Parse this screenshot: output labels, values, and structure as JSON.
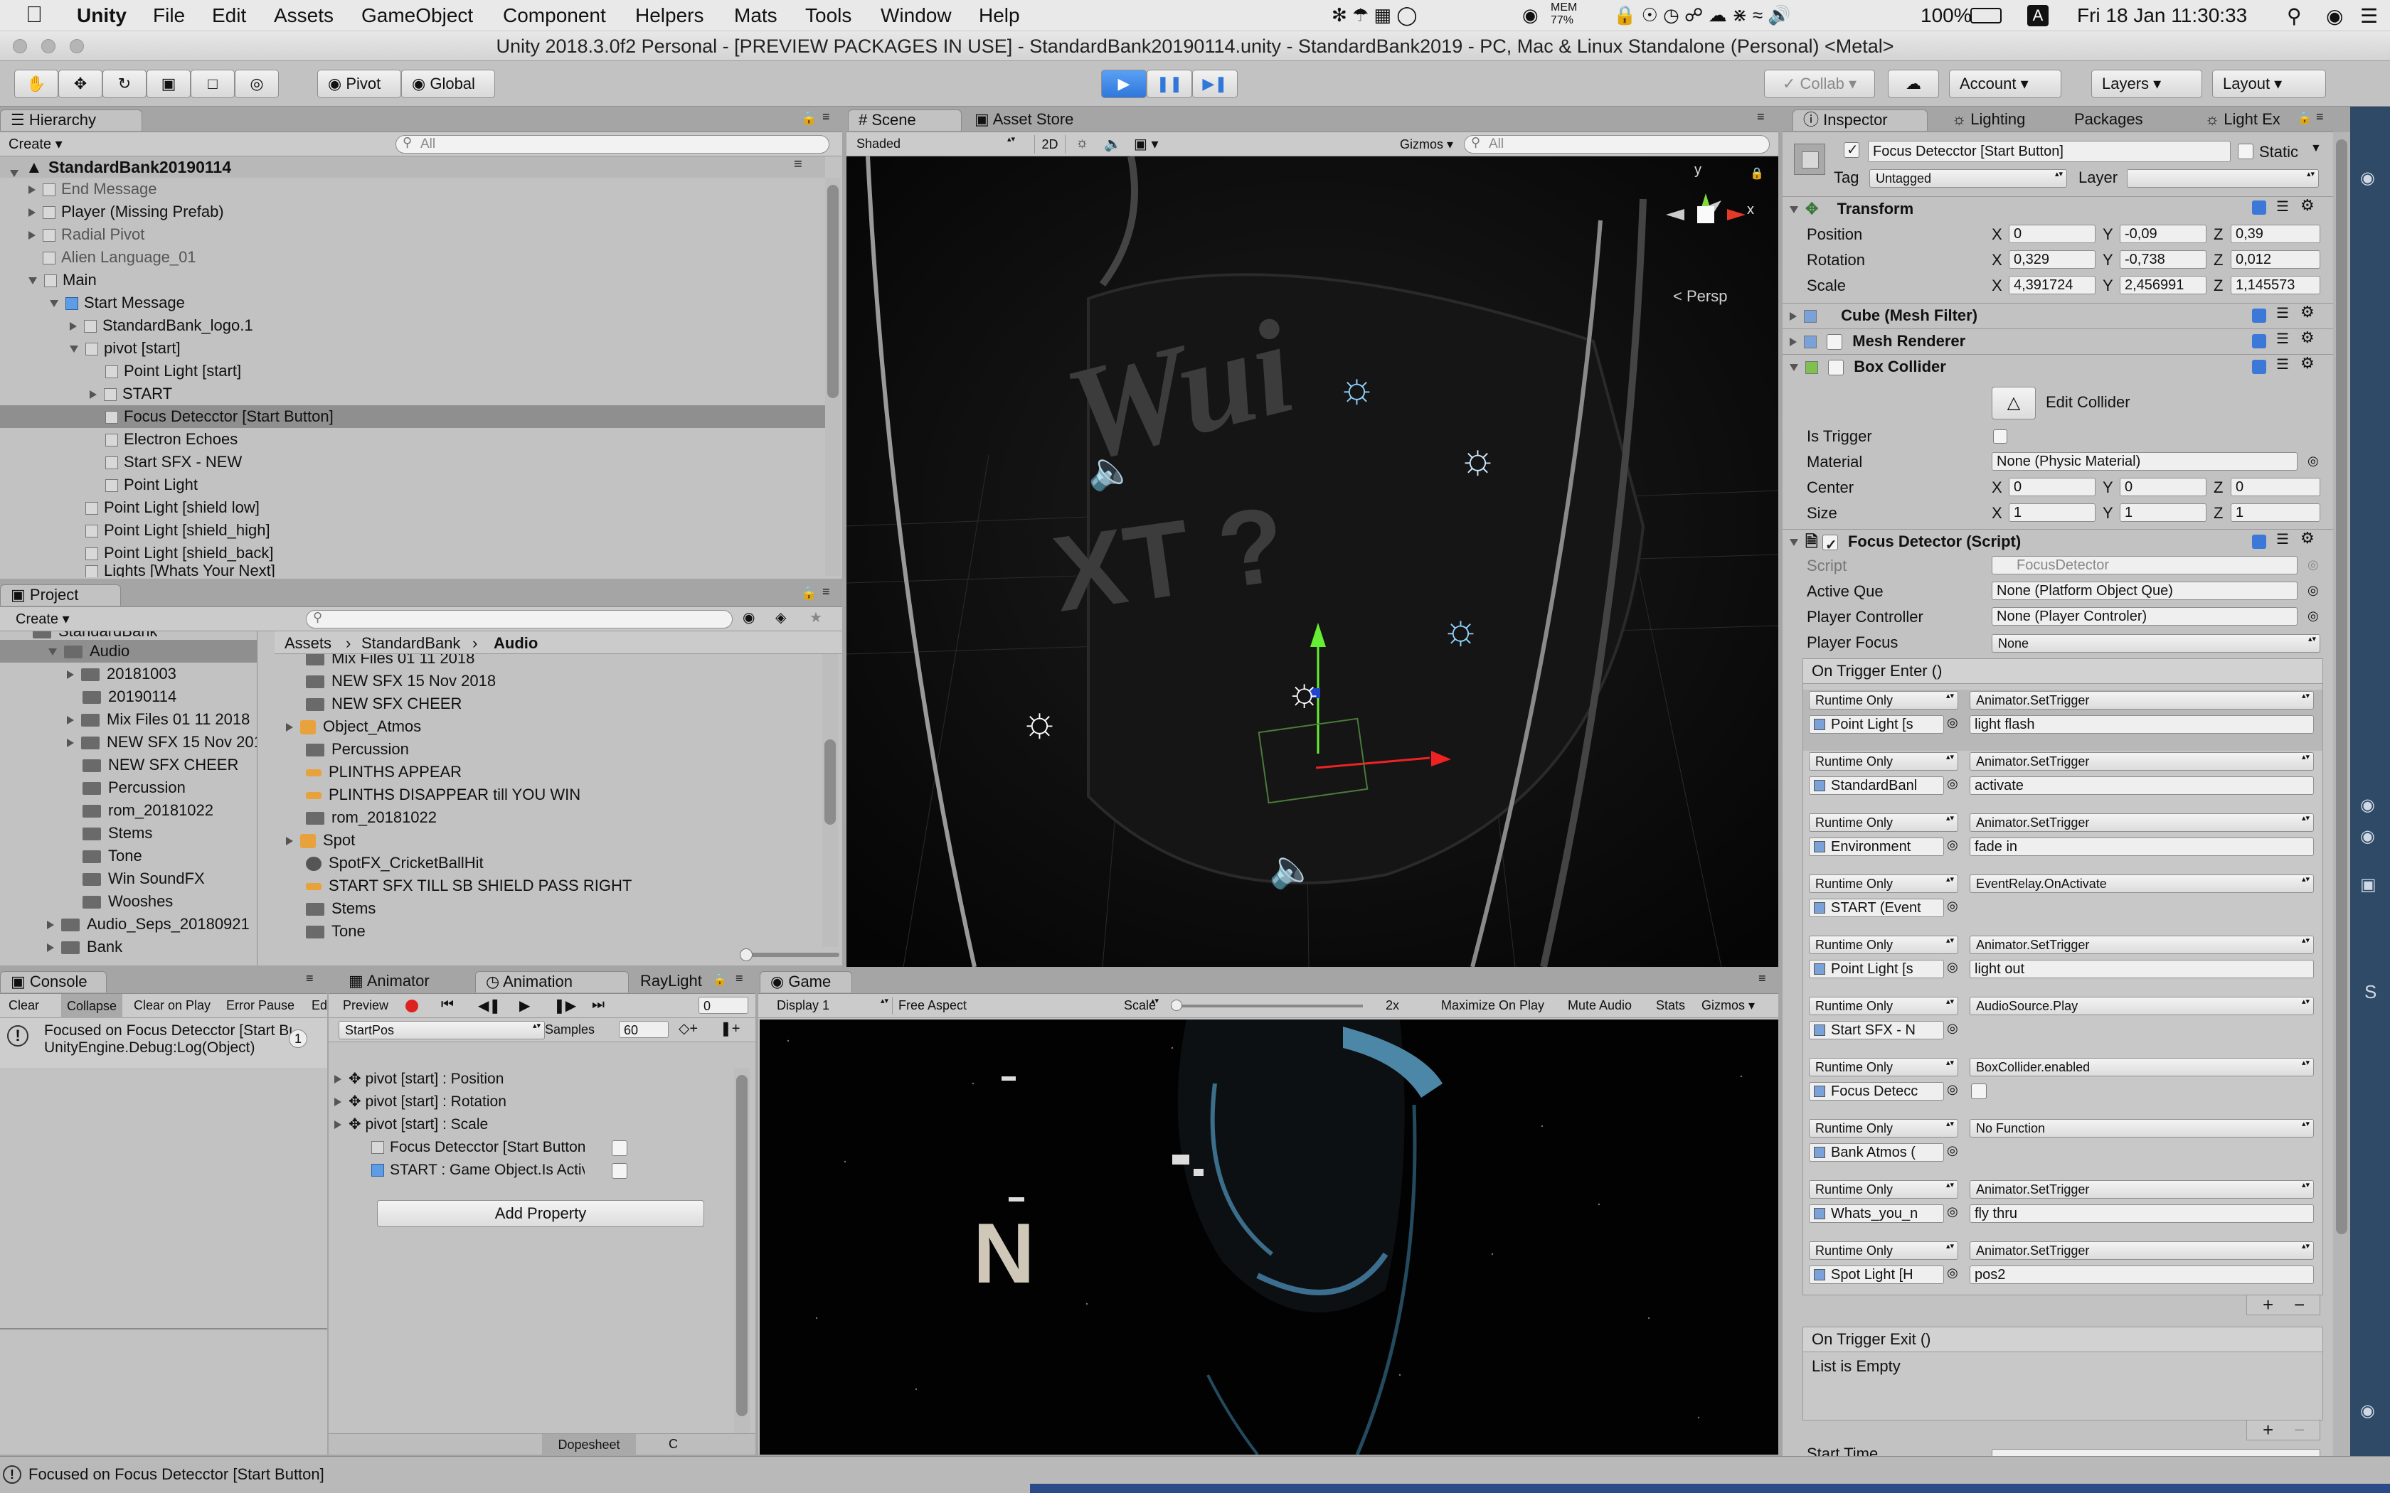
{
  "menubar": {
    "app": "Unity",
    "items": [
      "File",
      "Edit",
      "Assets",
      "GameObject",
      "Component",
      "Helpers",
      "Mats",
      "Tools",
      "Window",
      "Help"
    ],
    "mem": "MEM",
    "mem_pct": "77%",
    "battery": "100%",
    "datetime": "Fri 18 Jan  11:30:33"
  },
  "window_title": "Unity 2018.3.0f2 Personal - [PREVIEW PACKAGES IN USE] - StandardBank20190114.unity - StandardBank2019 - PC, Mac & Linux Standalone (Personal) <Metal>",
  "toolbar": {
    "pivot": "Pivot",
    "global": "Global",
    "collab": "Collab",
    "account": "Account",
    "layers": "Layers",
    "layout": "Layout"
  },
  "hierarchy": {
    "tab": "Hierarchy",
    "create": "Create",
    "search": "All",
    "scene": "StandardBank20190114",
    "rows": [
      "End Message",
      "Player (Missing Prefab)",
      "Radial Pivot",
      "Alien Language_01",
      "Main",
      "Start Message",
      "StandardBank_logo.1",
      "pivot [start]",
      "Point Light [start]",
      "START",
      "Focus Detecctor [Start Button]",
      "Electron Echoes",
      "Start SFX - NEW",
      "Point Light",
      "Point Light [shield low]",
      "Point Light [shield_high]",
      "Point Light [shield_back]",
      "Lights [Whats Your Next]"
    ]
  },
  "project": {
    "tab": "Project",
    "create": "Create",
    "tree": [
      "StandardBank",
      "Audio",
      "20181003",
      "20190114",
      "Mix Files 01 11 2018",
      "NEW SFX  15 Nov 2018",
      "NEW SFX CHEER",
      "Percussion",
      "rom_20181022",
      "Stems",
      "Tone",
      "Win SoundFX",
      "Wooshes",
      "Audio_Seps_20180921",
      "Bank"
    ],
    "breadcrumb": [
      "Assets",
      "StandardBank",
      "Audio"
    ],
    "files": [
      "Mix Files 01 11 2018",
      "NEW SFX  15 Nov 2018",
      "NEW SFX CHEER",
      "Object_Atmos",
      "Percussion",
      "PLINTHS APPEAR",
      "PLINTHS DISAPPEAR  till  YOU WIN",
      "rom_20181022",
      "Spot",
      "SpotFX_CricketBallHit",
      "START SFX  TILL SB SHIELD PASS RIGHT",
      "Stems",
      "Tone"
    ]
  },
  "scene": {
    "tab": "Scene",
    "tab2": "Asset Store",
    "shading": "Shaded",
    "mode2d": "2D",
    "gizmos": "Gizmos",
    "search": "All",
    "persp": "Persp",
    "axis_y": "y",
    "axis_x": "x",
    "bg_text1": "Wui",
    "bg_text2": "XT ?"
  },
  "console": {
    "tab": "Console",
    "buttons": [
      "Clear",
      "Collapse",
      "Clear on Play",
      "Error Pause",
      "Ed"
    ],
    "msg1": "Focused on Focus Detecctor [Start Button]",
    "msg2": "UnityEngine.Debug:Log(Object)",
    "count": "1"
  },
  "animation": {
    "tab1": "Animator",
    "tab2": "Animation",
    "tab3": "RayLight",
    "preview": "Preview",
    "frame": "0",
    "clip": "StartPos",
    "samples_label": "Samples",
    "samples": "60",
    "props": [
      "pivot [start] : Position",
      "pivot [start] : Rotation",
      "pivot [start] : Scale",
      "Focus Detecctor [Start Button]",
      "START : Game Object.Is Active"
    ],
    "add_property": "Add Property",
    "dopesheet": "Dopesheet",
    "curves": "C"
  },
  "game": {
    "tab": "Game",
    "display": "Display 1",
    "aspect": "Free Aspect",
    "scale_label": "Scale",
    "scale": "2x",
    "maximize": "Maximize On Play",
    "mute": "Mute Audio",
    "stats": "Stats",
    "gizmos": "Gizmos",
    "letter": "N"
  },
  "inspector": {
    "tab": "Inspector",
    "tab2": "Lighting",
    "tab3": "Packages",
    "tab4": "Light Ex",
    "name": "Focus Detecctor [Start Button]",
    "static": "Static",
    "tag_label": "Tag",
    "tag": "Untagged",
    "layer_label": "Layer",
    "layer": "",
    "transform": {
      "title": "Transform",
      "position": "Position",
      "rotation": "Rotation",
      "scale": "Scale",
      "px": "0",
      "py": "-0,09",
      "pz": "0,39",
      "rx": "0,329",
      "ry": "-0,738",
      "rz": "0,012",
      "sx": "4,391724",
      "sy": "2,456991",
      "sz": "1,145573"
    },
    "mesh_filter": "Cube (Mesh Filter)",
    "mesh_renderer": "Mesh Renderer",
    "box_collider": {
      "title": "Box Collider",
      "edit": "Edit Collider",
      "is_trigger": "Is Trigger",
      "material": "Material",
      "material_val": "None (Physic Material)",
      "center": "Center",
      "size": "Size",
      "cx": "0",
      "cy": "0",
      "cz": "0",
      "sx": "1",
      "sy": "1",
      "sz": "1"
    },
    "script": {
      "title": "Focus Detector (Script)",
      "script_label": "Script",
      "script_val": "FocusDetector",
      "active_que": "Active Que",
      "active_que_val": "None (Platform Object Que)",
      "player_controller": "Player Controller",
      "player_controller_val": "None (Player Controler)",
      "player_focus": "Player Focus",
      "player_focus_val": "None",
      "on_enter": "On Trigger Enter ()",
      "on_exit": "On Trigger Exit ()",
      "empty": "List is Empty",
      "start_time": "Start Time"
    },
    "events": [
      {
        "mode": "Runtime Only",
        "func": "Animator.SetTrigger",
        "obj": "Point Light [s",
        "arg": "light flash"
      },
      {
        "mode": "Runtime Only",
        "func": "Animator.SetTrigger",
        "obj": "StandardBanl",
        "arg": "activate"
      },
      {
        "mode": "Runtime Only",
        "func": "Animator.SetTrigger",
        "obj": "Environment",
        "arg": "fade in"
      },
      {
        "mode": "Runtime Only",
        "func": "EventRelay.OnActivate",
        "obj": "START (Event",
        "arg": ""
      },
      {
        "mode": "Runtime Only",
        "func": "Animator.SetTrigger",
        "obj": "Point Light [s",
        "arg": "light out"
      },
      {
        "mode": "Runtime Only",
        "func": "AudioSource.Play",
        "obj": "Start SFX - N",
        "arg": ""
      },
      {
        "mode": "Runtime Only",
        "func": "BoxCollider.enabled",
        "obj": "Focus Detecc",
        "arg": ""
      },
      {
        "mode": "Runtime Only",
        "func": "No Function",
        "obj": "Bank Atmos (",
        "arg": ""
      },
      {
        "mode": "Runtime Only",
        "func": "Animator.SetTrigger",
        "obj": "Whats_you_n",
        "arg": "fly thru"
      },
      {
        "mode": "Runtime Only",
        "func": "Animator.SetTrigger",
        "obj": "Spot Light [H",
        "arg": "pos2"
      }
    ]
  },
  "statusbar": "Focused on Focus Detecctor [Start Button]"
}
